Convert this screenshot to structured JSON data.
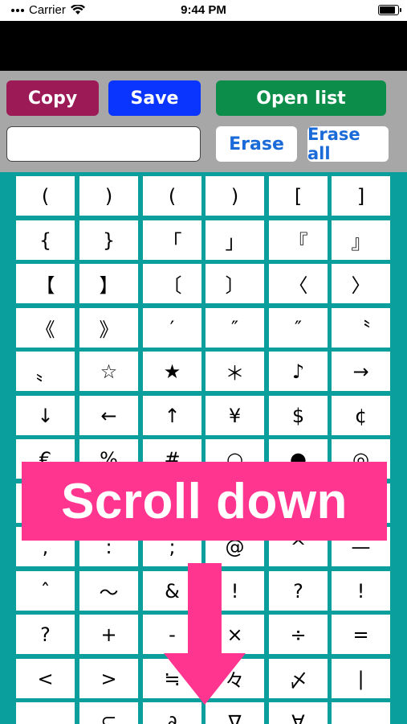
{
  "status_bar": {
    "carrier": "Carrier",
    "time": "9:44 PM"
  },
  "toolbar": {
    "copy_label": "Copy",
    "save_label": "Save",
    "open_list_label": "Open list",
    "erase_label": "Erase",
    "erase_all_label": "Erase all",
    "input_value": ""
  },
  "colors": {
    "copy": "#9c1b57",
    "save": "#0a35ff",
    "open_list": "#0c8e4a",
    "toolbar_bg": "#a7a7a7",
    "grid_bg": "#0a9f9d",
    "banner": "#ff3590",
    "erase_text": "#1a6ad8"
  },
  "symbols": [
    [
      "(",
      ")",
      "(",
      ")",
      "[",
      "]"
    ],
    [
      "{",
      "}",
      "「",
      "」",
      "『",
      "』"
    ],
    [
      "【",
      "】",
      "〔",
      "〕",
      "〈",
      "〉"
    ],
    [
      "《",
      "》",
      "′",
      "″",
      "″",
      "〝"
    ],
    [
      "〟",
      "☆",
      "★",
      "＊",
      "♪",
      "→"
    ],
    [
      "↓",
      "←",
      "↑",
      "¥",
      "$",
      "¢"
    ],
    [
      "€",
      "%",
      "#",
      "○",
      "●",
      "◎"
    ],
    [
      "¨",
      "·",
      "ー",
      "",
      "¨",
      "¨"
    ],
    [
      ",",
      ":",
      ";",
      "@",
      "^",
      "—"
    ],
    [
      "ˆ",
      "～",
      "&",
      "!",
      "?",
      "!"
    ],
    [
      "?",
      "+",
      "-",
      "×",
      "÷",
      "="
    ],
    [
      "<",
      ">",
      "≒",
      "々",
      "〆",
      "|"
    ],
    [
      "",
      "⊆",
      "∂",
      "∇",
      "∀",
      ""
    ]
  ],
  "overlay": {
    "banner_text": "Scroll down",
    "arrow_icon": "down-arrow-icon"
  }
}
